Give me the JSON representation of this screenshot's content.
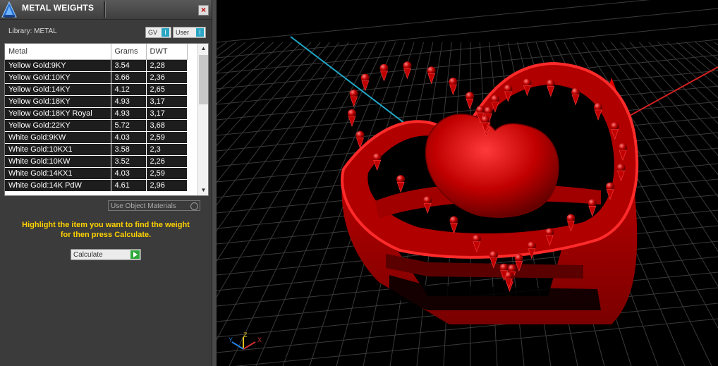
{
  "panel": {
    "title": "METAL WEIGHTS",
    "close_glyph": "×",
    "library_label": "Library: METAL",
    "toggle_gv": "GV",
    "toggle_user": "User",
    "toggle_indicator": "I",
    "table": {
      "columns": [
        "Metal",
        "Grams",
        "DWT"
      ],
      "rows": [
        [
          "Yellow Gold:9KY",
          "3.54",
          "2,28"
        ],
        [
          "Yellow Gold:10KY",
          "3.66",
          "2,36"
        ],
        [
          "Yellow Gold:14KY",
          "4.12",
          "2,65"
        ],
        [
          "Yellow Gold:18KY",
          "4.93",
          "3,17"
        ],
        [
          "Yellow Gold:18KY Royal",
          "4.93",
          "3,17"
        ],
        [
          "Yellow Gold:22KY",
          "5.72",
          "3,68"
        ],
        [
          "White Gold:9KW",
          "4.03",
          "2,59"
        ],
        [
          "White Gold:10KX1",
          "3.58",
          "2,3"
        ],
        [
          "White Gold:10KW",
          "3.52",
          "2,26"
        ],
        [
          "White Gold:14KX1",
          "4.03",
          "2,59"
        ],
        [
          "White Gold:14K PdW",
          "4.61",
          "2,96"
        ]
      ]
    },
    "use_object_materials": "Use Object Materials",
    "hint": [
      "Highlight the item you want to find the weight",
      "for then press Calculate."
    ],
    "calculate_label": "Calculate"
  },
  "viewport": {
    "axis_labels": {
      "x": "X",
      "y": "Y",
      "z": "Z"
    },
    "colors": {
      "model": "#d40000",
      "grid": "#3a3a3a",
      "x_axis": "#d02020",
      "y_axis": "#20a8c8"
    }
  }
}
